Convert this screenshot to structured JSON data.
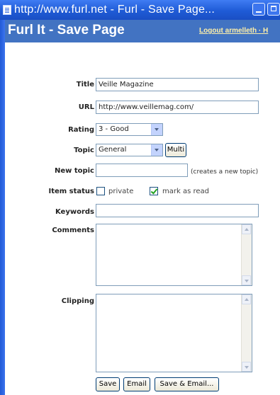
{
  "window": {
    "title": "http://www.furl.net - Furl - Save Page..."
  },
  "header": {
    "title": "Furl It - Save Page",
    "logout_link": "Logout armelleth",
    "separator": "·",
    "more_link": "H"
  },
  "form": {
    "title": {
      "label": "Title",
      "value": "Veille Magazine"
    },
    "url": {
      "label": "URL",
      "value": "http://www.veillemag.com/"
    },
    "rating": {
      "label": "Rating",
      "selected": "3 - Good"
    },
    "topic": {
      "label": "Topic",
      "selected": "General",
      "multi_label": "Multi"
    },
    "new_topic": {
      "label": "New topic",
      "value": "",
      "hint": "(creates a new topic)"
    },
    "item_status": {
      "label": "Item status",
      "private_label": "private",
      "private_checked": false,
      "read_label": "mark as read",
      "read_checked": true
    },
    "keywords": {
      "label": "Keywords",
      "value": ""
    },
    "comments": {
      "label": "Comments",
      "value": ""
    },
    "clipping": {
      "label": "Clipping",
      "value": ""
    }
  },
  "buttons": {
    "save": "Save",
    "email": "Email",
    "save_email": "Save & Email..."
  },
  "icons": {
    "app": "document-icon",
    "minimize": "minimize-icon",
    "maximize": "maximize-icon"
  },
  "colors": {
    "titlebar": "#2a63e0",
    "header_bg": "#4273c2",
    "link": "#fff0a8"
  }
}
